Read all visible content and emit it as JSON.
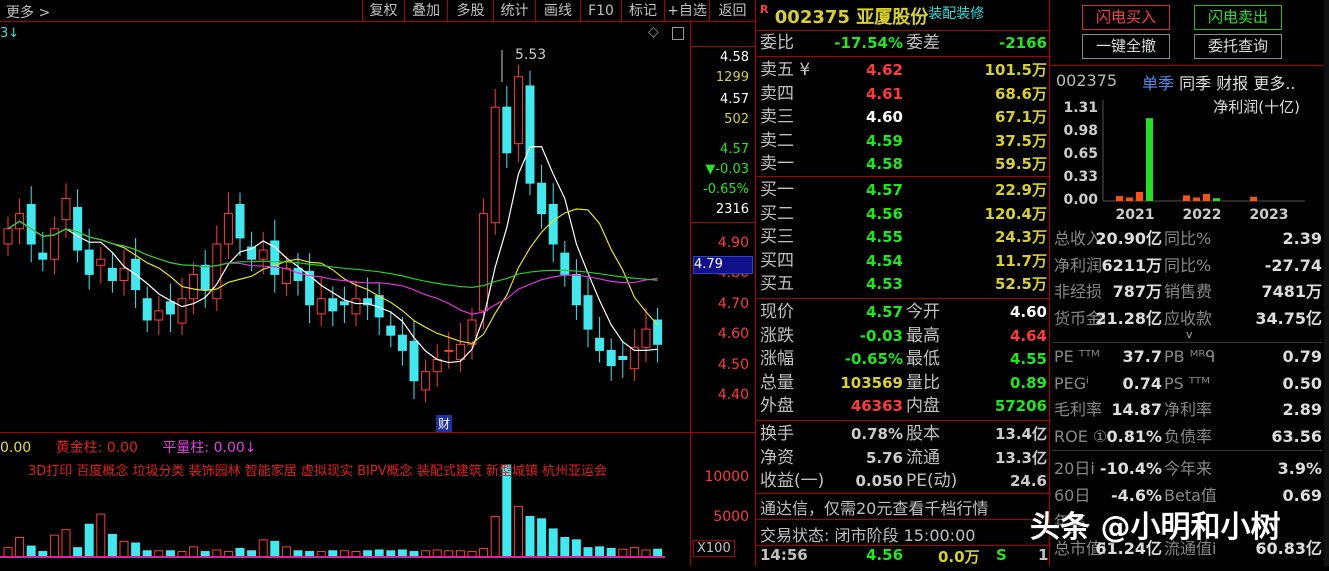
{
  "toolbar": {
    "more": "更多 >",
    "buttons": [
      "复权",
      "叠加",
      "多股",
      "统计",
      "画线",
      "F10",
      "标记",
      "+自选",
      "返回"
    ]
  },
  "chart": {
    "peak_label": "5.53",
    "finance_marker": "财",
    "indicator_arrow": "3↓",
    "price_axis": [
      "4.90",
      "4.80",
      "4.70",
      "4.60",
      "4.50",
      "4.40"
    ],
    "cursor_price": "4.79",
    "info": {
      "p1": "4.58",
      "v1": "1299",
      "p2": "4.57",
      "v2": "502",
      "price": "4.57",
      "chg": "▼-0.03",
      "pct": "-0.65%",
      "vol": "2316"
    },
    "kline": {
      "close": [
        4.95,
        5.0,
        4.9,
        4.85,
        4.95,
        5.05,
        4.88,
        4.8,
        4.85,
        4.78,
        4.82,
        4.75,
        4.65,
        4.68,
        4.67,
        4.72,
        4.8,
        4.75,
        4.9,
        5.0,
        4.92,
        4.85,
        4.88,
        4.8,
        4.82,
        4.78,
        4.7,
        4.72,
        4.68,
        4.7,
        4.72,
        4.7,
        4.66,
        4.6,
        4.55,
        4.45,
        4.48,
        4.52,
        4.55,
        4.57,
        4.65,
        5.0,
        5.35,
        5.2,
        5.45,
        5.1,
        5.0,
        4.9,
        4.8,
        4.7,
        4.62,
        4.55,
        4.5,
        4.52,
        4.56,
        4.62,
        4.57
      ],
      "volume": [
        1200,
        2500,
        1400,
        700,
        2800,
        3500,
        1200,
        4200,
        5500,
        2900,
        2000,
        1800,
        800,
        800,
        800,
        700,
        1300,
        700,
        900,
        700,
        1100,
        800,
        2200,
        2000,
        1300,
        800,
        700,
        700,
        800,
        800,
        700,
        800,
        900,
        800,
        900,
        700,
        800,
        900,
        800,
        800,
        700,
        1100,
        5200,
        11800,
        6500,
        5200,
        4900,
        3600,
        2500,
        2200,
        1200,
        1300,
        1100,
        1000,
        1200,
        900,
        1000
      ]
    },
    "colors": {
      "up": "#ff3a3a",
      "down": "#40e8f0",
      "ma5": "#ffffff",
      "ma10": "#e8e020",
      "ma20": "#e030e0",
      "ma60": "#20d020"
    }
  },
  "volume": {
    "legend": [
      {
        "label": "0.00",
        "color": "#e8e020"
      },
      {
        "label": "黄金柱: 0.00",
        "color": "#e02020"
      },
      {
        "label": "平量柱: 0.00↓",
        "color": "#e040e0"
      }
    ],
    "concepts": "3D打印 百度概念 垃圾分类 装饰园林 智能家居 虚拟现实 BIPV概念 装配式建筑 新型城镇 杭州亚运会",
    "axis": [
      "10000",
      "5000"
    ],
    "unit": "X100"
  },
  "quote": {
    "flag": "R",
    "code": "002375",
    "name": "亚厦股份",
    "industry": "装配装修",
    "weibi_label": "委比",
    "weibi": "-17.54%",
    "weicha_label": "委差",
    "weicha": "-2166",
    "sells": [
      {
        "l": "卖五 ¥",
        "p": "4.62",
        "v": "101.5万",
        "c": "r"
      },
      {
        "l": "卖四",
        "p": "4.61",
        "v": "68.6万",
        "c": "r"
      },
      {
        "l": "卖三",
        "p": "4.60",
        "v": "67.1万",
        "c": "w"
      },
      {
        "l": "卖二",
        "p": "4.59",
        "v": "37.5万",
        "c": "g"
      },
      {
        "l": "卖一",
        "p": "4.58",
        "v": "59.5万",
        "c": "g"
      }
    ],
    "buys": [
      {
        "l": "买一",
        "p": "4.57",
        "v": "22.9万",
        "c": "g"
      },
      {
        "l": "买二",
        "p": "4.56",
        "v": "120.4万",
        "c": "g"
      },
      {
        "l": "买三",
        "p": "4.55",
        "v": "24.3万",
        "c": "g"
      },
      {
        "l": "买四",
        "p": "4.54",
        "v": "11.7万",
        "c": "g"
      },
      {
        "l": "买五",
        "p": "4.53",
        "v": "52.5万",
        "c": "g"
      }
    ],
    "stats": [
      {
        "l": "现价",
        "v": "4.57",
        "c": "g",
        "l2": "今开",
        "v2": "4.60",
        "c2": "w"
      },
      {
        "l": "涨跌",
        "v": "-0.03",
        "c": "g",
        "l2": "最高",
        "v2": "4.64",
        "c2": "r"
      },
      {
        "l": "涨幅",
        "v": "-0.65%",
        "c": "g",
        "l2": "最低",
        "v2": "4.55",
        "c2": "g"
      },
      {
        "l": "总量",
        "v": "103569",
        "c": "y",
        "l2": "量比",
        "v2": "0.89",
        "c2": "g"
      },
      {
        "l": "外盘",
        "v": "46363",
        "c": "r",
        "l2": "内盘",
        "v2": "57206",
        "c2": "g"
      }
    ],
    "stats2": [
      {
        "l": "换手",
        "v": "0.78%",
        "l2": "股本",
        "v2": "13.4亿"
      },
      {
        "l": "净资",
        "v": "5.76",
        "l2": "流通",
        "v2": "13.3亿"
      },
      {
        "l": "收益(一)",
        "v": "0.050",
        "l2": "PE(动)",
        "v2": "24.6"
      }
    ],
    "ad": "通达信，仅需20元查看千档行情",
    "status": "交易状态: 闭市阶段 15:00:00",
    "tick": {
      "time": "14:56",
      "price": "4.56",
      "vol": "0.0万",
      "side": "S",
      "n": "1"
    }
  },
  "right": {
    "buttons": {
      "buy": "闪电买入",
      "sell": "闪电卖出",
      "cancel": "一键全撤",
      "query": "委托查询"
    },
    "code": "002375",
    "tabs": [
      "单季",
      "同季",
      "财报",
      "更多.."
    ],
    "fin_chart": {
      "title": "净利润(十亿)",
      "y_ticks": [
        "1.31",
        "0.98",
        "0.65",
        "0.33",
        "0.00"
      ],
      "years": [
        "2021",
        "2022",
        "2023"
      ],
      "values": [
        0.07,
        0.05,
        0.13,
        1.18,
        0.08,
        0.05,
        0.1,
        0.04,
        0.06
      ],
      "colors": [
        "#ff5010",
        "#ff5010",
        "#ff5010",
        "#20e020",
        "#ff5010",
        "#ff5010",
        "#ff5010",
        "#20e020",
        "#ff5010"
      ]
    },
    "rows": [
      {
        "l": "总收入",
        "v": "20.90亿",
        "l2": "同比%",
        "v2": "2.39"
      },
      {
        "l": "净利润",
        "v": "6211万",
        "l2": "同比%",
        "v2": "-27.74"
      },
      {
        "l": "非经损",
        "v": "787万",
        "l2": "销售费",
        "v2": "7481万"
      },
      {
        "l": "货币金i",
        "v": "21.28亿",
        "l2": "应收款",
        "v2": "34.75亿"
      }
    ],
    "rows2": [
      {
        "l": "PE ᵀᵀᴹ",
        "v": "37.7",
        "l2": "PB ᴹᴿᑫ",
        "v2": "0.79"
      },
      {
        "l": "PEGⁱ",
        "v": "0.74",
        "l2": "PS ᵀᵀᴹ",
        "v2": "0.50"
      },
      {
        "l": "毛利率",
        "v": "14.87",
        "l2": "净利率",
        "v2": "2.89"
      },
      {
        "l": "ROE ①",
        "v": "0.81%",
        "l2": "负债率",
        "v2": "63.56"
      }
    ],
    "rows3": [
      {
        "l": "20日i",
        "v": "-10.4%",
        "l2": "今年来",
        "v2": "3.9%"
      },
      {
        "l": "60日",
        "v": "-4.6%",
        "l2": "Beta值",
        "v2": "0.69"
      },
      {
        "l": "年高",
        "v": "",
        "l2": "",
        "v2": ""
      },
      {
        "l": "总市值i",
        "v": "61.24亿",
        "l2": "流通值i",
        "v2": "60.83亿"
      }
    ]
  },
  "watermark": "头条 @小明和小树"
}
